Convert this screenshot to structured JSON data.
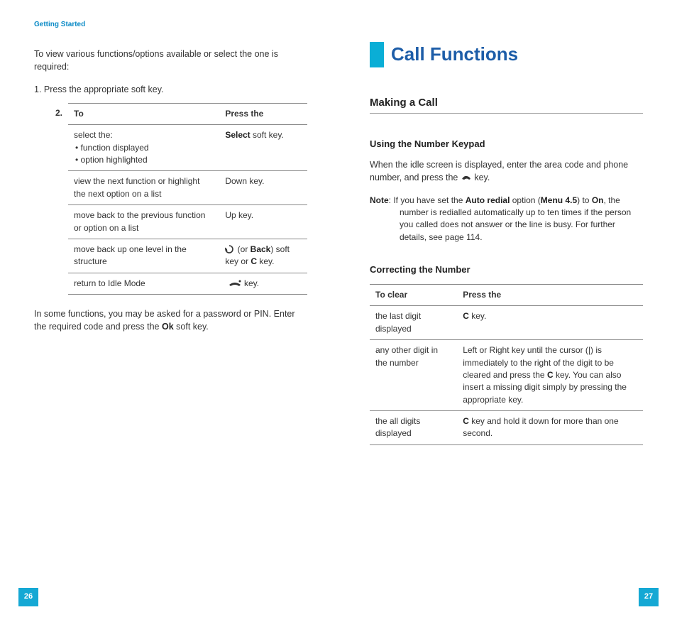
{
  "left": {
    "section": "Getting Started",
    "intro": "To view various functions/options available or select the one is required:",
    "step1": "1.  Press the appropriate soft key.",
    "table_num": "2.",
    "th_to": "To",
    "th_press": "Press the",
    "rows": [
      {
        "to": "select the:",
        "b1": "• function displayed",
        "b2": "• option highlighted",
        "p_pre": "",
        "p_bold": "Select",
        "p_post": " soft key."
      },
      {
        "to": "view the next function or highlight the next option on a list",
        "p": "Down key."
      },
      {
        "to": "move back to the previous function or option on a list",
        "p": "Up key."
      },
      {
        "to": "move back up one level in the structure",
        "p_icon": "back-arrow-icon",
        "p_mid": " (or ",
        "p_bold": "Back",
        "p_post2": ") soft key or ",
        "p_bold2": "C",
        "p_post3": " key."
      },
      {
        "to": "return to Idle Mode",
        "p_icon": "end-call-icon",
        "p_post": " key."
      }
    ],
    "outro_a": "In some functions, you may be asked for a password or PIN. Enter the required code and press the ",
    "outro_bold": "Ok",
    "outro_b": " soft key.",
    "page": "26"
  },
  "right": {
    "chapter": "Call Functions",
    "h2": "Making a Call",
    "h3a": "Using the Number Keypad",
    "para1a": "When the idle screen is displayed, enter the area code and phone number, and press the ",
    "para1b": " key.",
    "note_label": "Note",
    "note_a": ": If you have set the ",
    "note_b1": "Auto redial",
    "note_c": " option (",
    "note_b2": "Menu 4.5",
    "note_d": ") to ",
    "note_b3": "On",
    "note_e": ", the number is redialled automatically up to ten times if the person you called does not answer or the line is busy. For further details, see page 114.",
    "h3b": "Correcting the Number",
    "th_clear": "To clear",
    "th_press": "Press the",
    "rows": [
      {
        "c": "the last digit displayed",
        "p_bold": "C",
        "p_post": " key."
      },
      {
        "c": "any other digit in the number",
        "p_a": "Left or Right key until the cursor (|) is immediately to the right of the digit to be cleared and press the ",
        "p_bold": "C",
        "p_b": " key. You can also insert a missing digit simply by pressing the appropriate key."
      },
      {
        "c": "the all digits displayed",
        "p_bold": "C",
        "p_post": " key and hold it down for more than one second."
      }
    ],
    "page": "27"
  }
}
